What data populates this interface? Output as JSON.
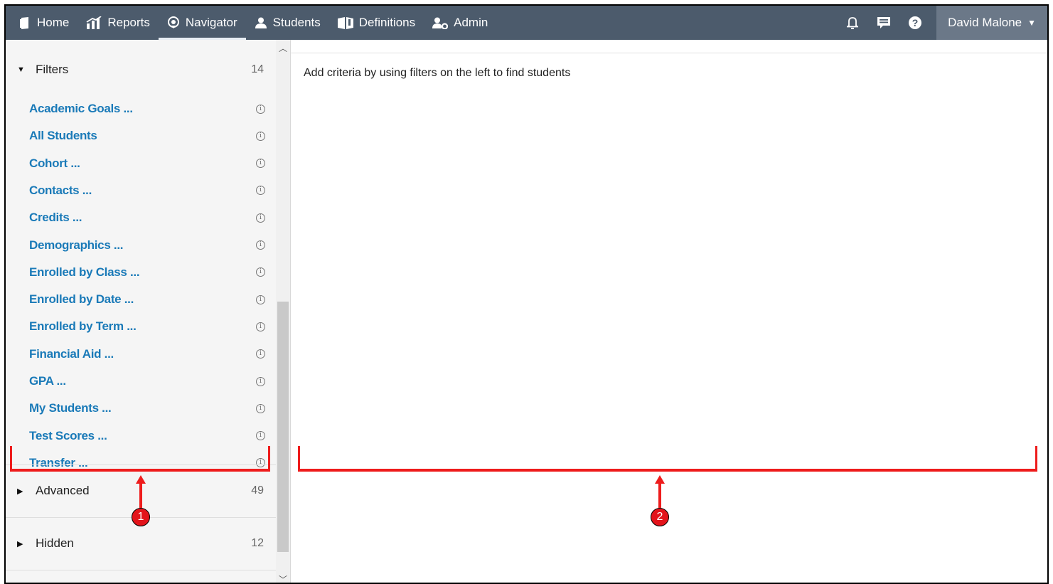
{
  "nav": {
    "items": [
      {
        "label": "Home",
        "icon": "home-icon"
      },
      {
        "label": "Reports",
        "icon": "reports-icon"
      },
      {
        "label": "Navigator",
        "icon": "navigator-icon",
        "active": true
      },
      {
        "label": "Students",
        "icon": "students-icon"
      },
      {
        "label": "Definitions",
        "icon": "definitions-icon"
      },
      {
        "label": "Admin",
        "icon": "admin-icon"
      }
    ],
    "right_icons": [
      "bell-icon",
      "chat-icon",
      "help-icon"
    ],
    "user": "David Malone"
  },
  "sidebar": {
    "filters": {
      "label": "Filters",
      "count": "14"
    },
    "filter_items": [
      "Academic Goals ...",
      "All Students",
      "Cohort ...",
      "Contacts ...",
      "Credits ...",
      "Demographics ...",
      "Enrolled by Class ...",
      "Enrolled by Date ...",
      "Enrolled by Term ...",
      "Financial Aid ...",
      "GPA ...",
      "My Students ...",
      "Test Scores ...",
      "Transfer ..."
    ],
    "advanced": {
      "label": "Advanced",
      "count": "49"
    },
    "hidden": {
      "label": "Hidden",
      "count": "12"
    }
  },
  "main": {
    "message": "Add criteria by using filters on the left to find students"
  },
  "annotations": {
    "callout_1": "1",
    "callout_2": "2"
  },
  "colors": {
    "nav_bg": "#4c5b6c",
    "link": "#1a7ab8",
    "annotation": "#ee1c1c"
  }
}
